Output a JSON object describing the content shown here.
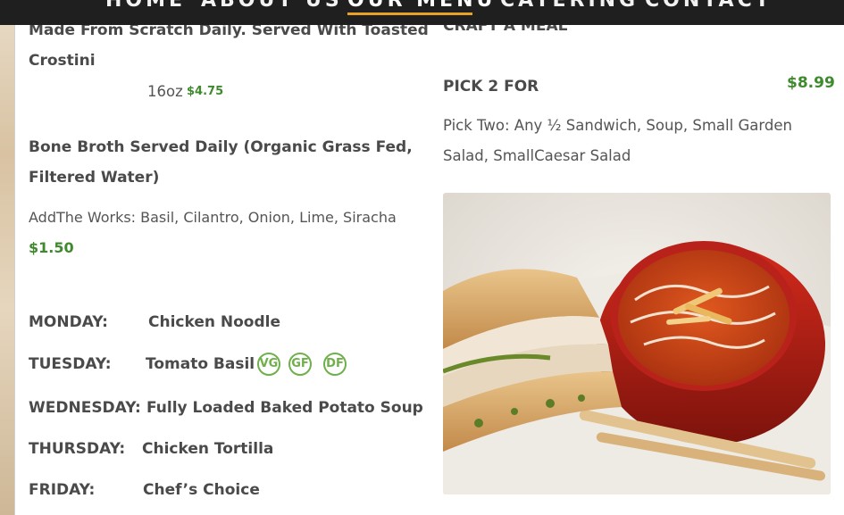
{
  "nav": {
    "items": [
      "HOME",
      "ABOUT US",
      "OUR MENU",
      "CATERING",
      "CONTACT"
    ],
    "active": "OUR MENU"
  },
  "left": {
    "soup_desc_line1": "Made From Scratch Daily. Served With Toasted",
    "soup_desc_line2": "Crostini",
    "size": "16oz",
    "size_price": "$4.75",
    "broth_line1": "Bone Broth Served Daily (Organic Grass Fed,",
    "broth_line2": "Filtered Water)",
    "addon_text": "AddThe Works: Basil, Cilantro, Onion, Lime, Siracha",
    "addon_price": "$1.50",
    "schedule": [
      {
        "day": "MONDAY:",
        "soup": "Chicken Noodle"
      },
      {
        "day": "TUESDAY:",
        "soup": "Tomato Basil"
      },
      {
        "day": "WEDNESDAY:",
        "soup": "Fully Loaded Baked Potato Soup"
      },
      {
        "day": "THURSDAY:",
        "soup": "Chicken Tortilla"
      },
      {
        "day": "FRIDAY:",
        "soup": "Chef’s Choice"
      }
    ],
    "badges": [
      "VG",
      "GF",
      "DF"
    ]
  },
  "right": {
    "section_title": "CRAFT A MEAL",
    "item_name": "PICK 2 FOR",
    "item_price": "$8.99",
    "item_desc_line1": "Pick Two: Any ½ Sandwich, Soup, Small Garden",
    "item_desc_line2": "Salad, SmallCaesar Salad"
  },
  "colors": {
    "price_green": "#3f8a2e",
    "badge_green": "#6fb04a",
    "nav_bg": "#1f1f1f",
    "nav_accent": "#e8a126"
  }
}
